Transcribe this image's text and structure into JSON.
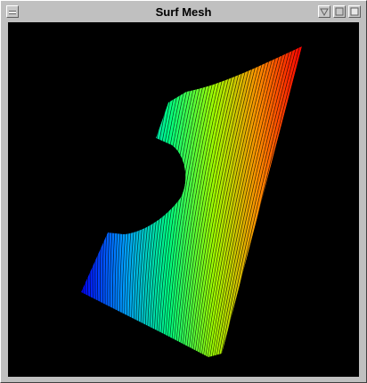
{
  "window": {
    "title": "Surf Mesh"
  },
  "icons": {
    "menu": "window-menu-icon",
    "minimize": "minimize-icon",
    "maximize": "maximize-icon",
    "close": "close-icon"
  },
  "colors": {
    "background": "#000000",
    "frame": "#c0c0c0",
    "gradient": [
      "#0000ff",
      "#00c8ff",
      "#00ff60",
      "#d0ff00",
      "#ff8000",
      "#ff0000"
    ]
  }
}
